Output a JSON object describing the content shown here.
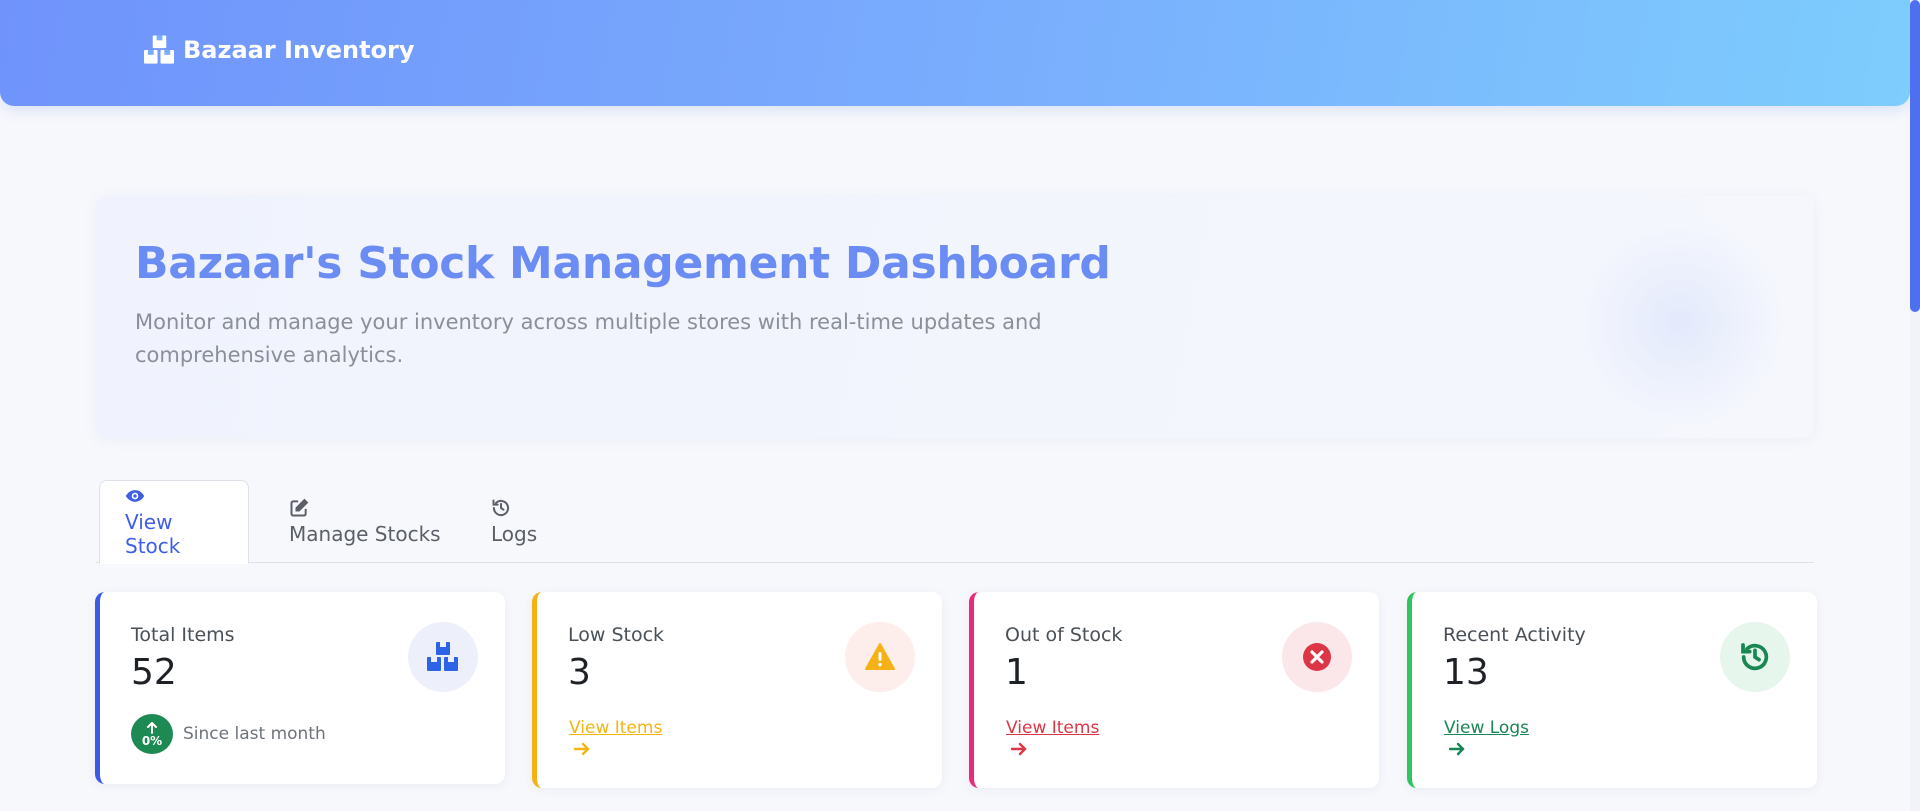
{
  "navbar": {
    "brand_label": "Bazaar Inventory",
    "brand_icon": "boxes-icon",
    "gradient": [
      "#6f93fb",
      "#7dcdfd"
    ]
  },
  "hero": {
    "title": "Bazaar's Stock Management Dashboard",
    "subtitle": "Monitor and manage your inventory across multiple stores with real-time updates and comprehensive analytics."
  },
  "tabs": [
    {
      "label": "View Stock",
      "icon": "eye-icon",
      "active": true
    },
    {
      "label": "Manage Stocks",
      "icon": "edit-icon",
      "active": false
    },
    {
      "label": "Logs",
      "icon": "history-icon",
      "active": false
    }
  ],
  "cards": [
    {
      "title": "Total Items",
      "value": "52",
      "icon": "boxes-icon",
      "accent": "#3b5ae6",
      "trend": {
        "badge": "0%",
        "text": "Since last month"
      }
    },
    {
      "title": "Low Stock",
      "value": "3",
      "icon": "warning-icon",
      "accent": "#f6b116",
      "link": "View Items"
    },
    {
      "title": "Out of Stock",
      "value": "1",
      "icon": "x-circle-icon",
      "accent": "#ea2a7c",
      "link": "View Items"
    },
    {
      "title": "Recent Activity",
      "value": "13",
      "icon": "history-icon",
      "accent": "#2fc45e",
      "link": "View Logs"
    }
  ],
  "colors": {
    "primary": "#3f5ee8",
    "hero_title": "#6b8cf3",
    "success": "#198754",
    "warning": "#f2b512",
    "danger": "#dc3545"
  }
}
